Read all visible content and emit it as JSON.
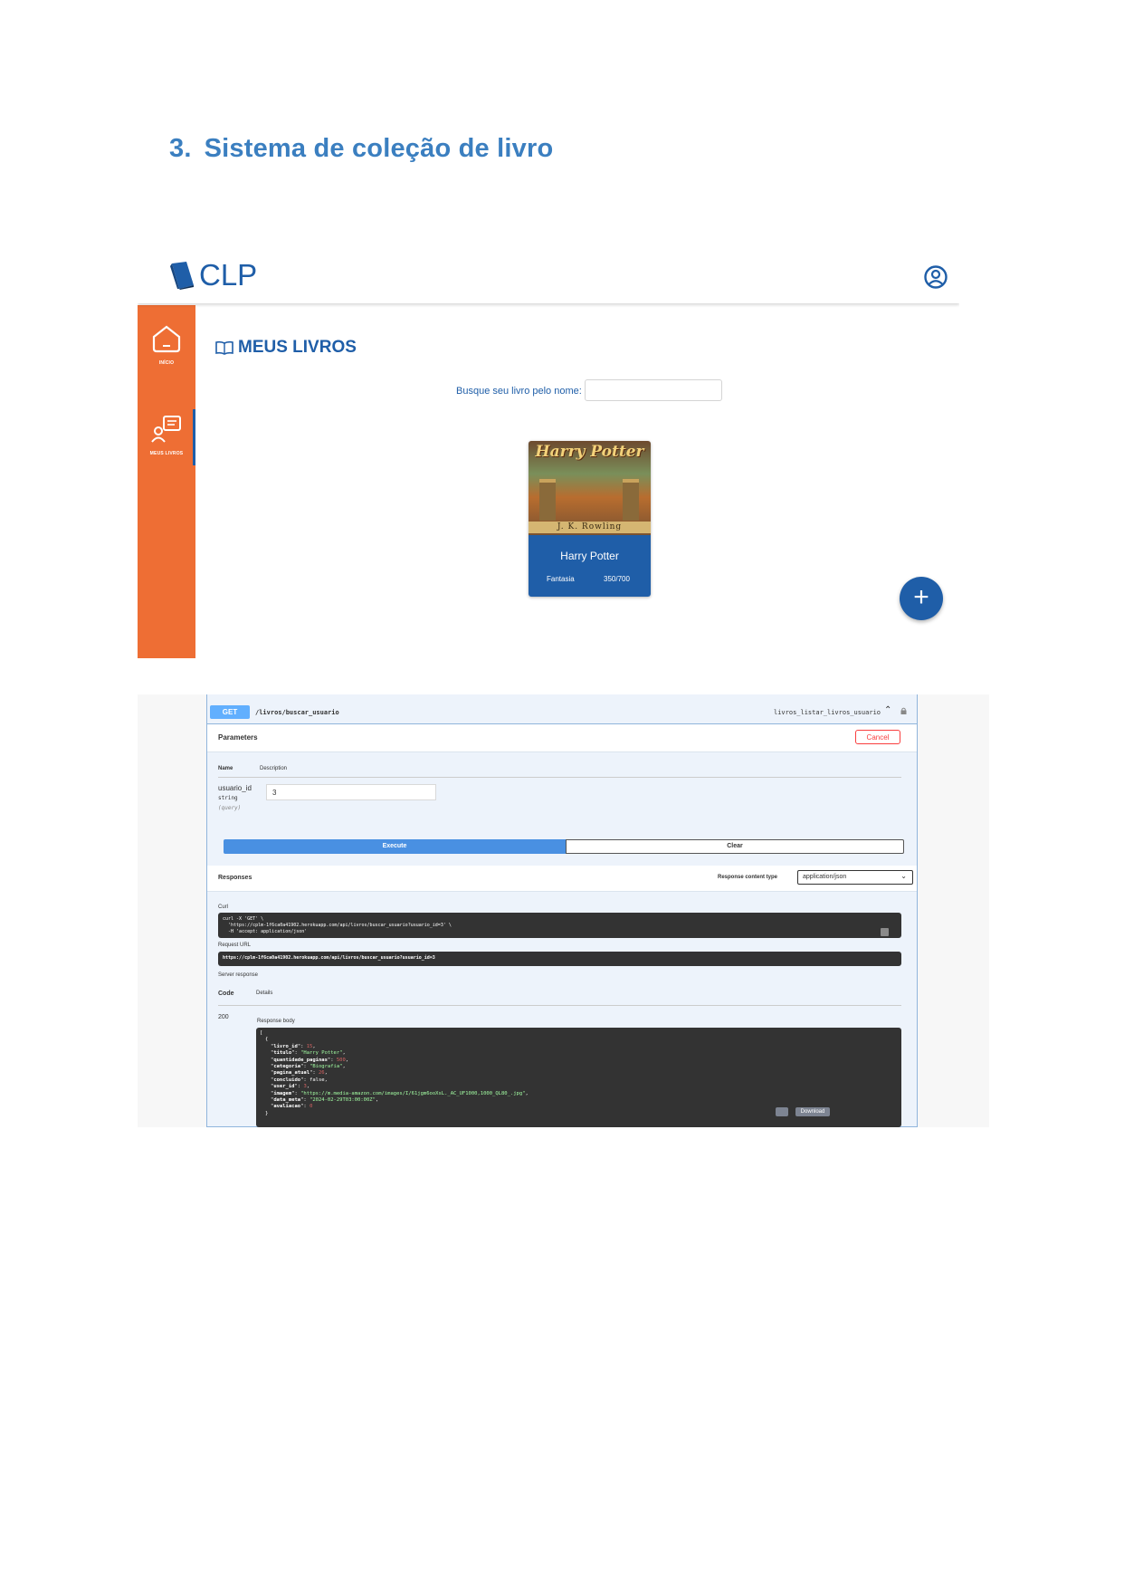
{
  "heading": {
    "number": "3.",
    "title": "Sistema de coleção de livro"
  },
  "app": {
    "logo_text": "CLP",
    "nav": [
      {
        "label": "INÍCIO",
        "icon": "home-icon"
      },
      {
        "label": "MEUS LIVROS",
        "icon": "user-books-icon"
      }
    ],
    "page_title": "MEUS LIVROS",
    "search_label": "Busque seu livro pelo nome:",
    "search_value": "",
    "book": {
      "cover_title": "Harry Potter",
      "cover_author": "J. K. Rowling",
      "title": "Harry Potter",
      "category": "Fantasia",
      "progress": "350/700"
    },
    "fab_label": "+",
    "colors": {
      "primary": "#1f5ea8",
      "sidebar": "#ee6e34"
    }
  },
  "swagger": {
    "method": "GET",
    "path": "/livros/buscar_usuario",
    "operation_id": "livros_listar_livros_usuario",
    "parameters_title": "Parameters",
    "cancel_label": "Cancel",
    "col_name": "Name",
    "col_description": "Description",
    "param": {
      "name": "usuario_id",
      "type": "string",
      "in": "(query)",
      "value": "3"
    },
    "execute_label": "Execute",
    "clear_label": "Clear",
    "responses_title": "Responses",
    "response_content_type_label": "Response content type",
    "response_content_type": "application/json",
    "curl_label": "Curl",
    "curl": "curl -X 'GET' \\\n  'https://cplm-1f6ca0a41902.herokuapp.com/api/livros/buscar_usuario?usuario_id=3' \\\n  -H 'accept: application/json'",
    "request_url_label": "Request URL",
    "request_url": "https://cplm-1f6ca0a41902.herokuapp.com/api/livros/buscar_usuario?usuario_id=3",
    "server_response_label": "Server response",
    "code_label": "Code",
    "details_label": "Details",
    "status_code": "200",
    "response_body_label": "Response body",
    "response_body": [
      {
        "key": "livro_id",
        "value": "15",
        "kind": "n"
      },
      {
        "key": "titulo",
        "value": "\"Harry Potter\"",
        "kind": "s"
      },
      {
        "key": "quantidade_paginas",
        "value": "500",
        "kind": "n"
      },
      {
        "key": "categoria",
        "value": "\"Biografia\"",
        "kind": "s"
      },
      {
        "key": "pagina_atual",
        "value": "26",
        "kind": "n"
      },
      {
        "key": "concluido",
        "value": "false",
        "kind": "b"
      },
      {
        "key": "user_id",
        "value": "3",
        "kind": "n"
      },
      {
        "key": "imagem",
        "value": "\"https://m.media-amazon.com/images/I/61jgm6ooXsL._AC_UF1000,1000_QL80_.jpg\"",
        "kind": "s"
      },
      {
        "key": "data_meta",
        "value": "\"2024-02-29T03:00:00Z\"",
        "kind": "s"
      },
      {
        "key": "avaliacao",
        "value": "0",
        "kind": "n"
      }
    ],
    "download_label": "Download"
  }
}
